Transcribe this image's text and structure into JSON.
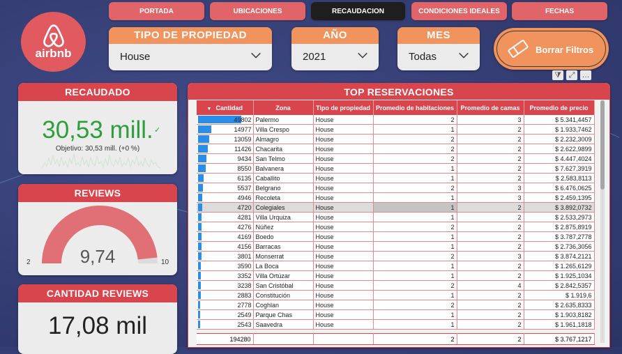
{
  "brand": {
    "logo_text": "airbnb",
    "color": "#e05a5f"
  },
  "nav": {
    "tabs": [
      "PORTADA",
      "UBICACIONES",
      "RECAUDACION",
      "CONDICIONES IDEALES",
      "FECHAS"
    ],
    "active": "RECAUDACION"
  },
  "filters": {
    "tipo": {
      "label": "TIPO DE PROPIEDAD",
      "value": "House"
    },
    "anio": {
      "label": "AÑO",
      "value": "2021"
    },
    "mes": {
      "label": "MES",
      "value": "Todas"
    },
    "clear_label": "Borrar Filtros"
  },
  "cards": {
    "recaudado": {
      "title": "RECAUDADO",
      "value": "30,53 mill.",
      "goal": "Objetivo: 30,53 mill. (+0 %)"
    },
    "reviews": {
      "title": "REVIEWS",
      "value": "9,74",
      "min": "2",
      "max": "10",
      "gauge_value": 9.74,
      "gauge_min": 2,
      "gauge_max": 10
    },
    "cantidad": {
      "title": "CANTIDAD REVIEWS",
      "value": "17,08 mil"
    }
  },
  "table": {
    "title": "TOP RESERVACIONES",
    "columns": [
      "Cantidad",
      "Zona",
      "Tipo de propiedad",
      "Promedio de habitaciones",
      "Promedio de camas",
      "Promedio de precio"
    ],
    "rows": [
      [
        "49802",
        "Palermo",
        "House",
        "2",
        "3",
        "$ 5.341,4457"
      ],
      [
        "14977",
        "Villa Crespo",
        "House",
        "1",
        "2",
        "$ 1.933,7462"
      ],
      [
        "13059",
        "Almagro",
        "House",
        "2",
        "2",
        "$ 2.232,3009"
      ],
      [
        "11426",
        "Chacarita",
        "House",
        "2",
        "2",
        "$ 2.622,9899"
      ],
      [
        "9434",
        "San Telmo",
        "House",
        "2",
        "2",
        "$ 4.447,4024"
      ],
      [
        "8550",
        "Balvanera",
        "House",
        "1",
        "2",
        "$ 7.627,3919"
      ],
      [
        "6135",
        "Caballito",
        "House",
        "1",
        "2",
        "$ 2.583,8113"
      ],
      [
        "5537",
        "Belgrano",
        "House",
        "2",
        "3",
        "$ 6.476,0625"
      ],
      [
        "4946",
        "Recoleta",
        "House",
        "1",
        "3",
        "$ 2.459,1395"
      ],
      [
        "4720",
        "Colegiales",
        "House",
        "1",
        "2",
        "$ 3.892,0732"
      ],
      [
        "4281",
        "Villa Urquiza",
        "House",
        "1",
        "2",
        "$ 2.533,2973"
      ],
      [
        "4276",
        "Núñez",
        "House",
        "2",
        "2",
        "$ 2.875,8919"
      ],
      [
        "4169",
        "Boedo",
        "House",
        "1",
        "2",
        "$ 3.787,2778"
      ],
      [
        "4156",
        "Barracas",
        "House",
        "1",
        "2",
        "$ 2.736,3056"
      ],
      [
        "3801",
        "Monserrat",
        "House",
        "2",
        "3",
        "$ 3.874,2121"
      ],
      [
        "3590",
        "La Boca",
        "House",
        "1",
        "2",
        "$ 1.265,6129"
      ],
      [
        "3352",
        "Villa Ortúzar",
        "House",
        "1",
        "2",
        "$ 1.925,1034"
      ],
      [
        "3238",
        "San Cristóbal",
        "House",
        "2",
        "4",
        "$ 2.842,5357"
      ],
      [
        "2883",
        "Constitución",
        "House",
        "1",
        "2",
        "$ 1.919,6"
      ],
      [
        "2778",
        "Coghlan",
        "House",
        "2",
        "2",
        "$ 2.635,8333"
      ],
      [
        "2549",
        "Parque Chas",
        "House",
        "1",
        "2",
        "$ 1.903,8182"
      ],
      [
        "2543",
        "Saavedra",
        "House",
        "1",
        "2",
        "$ 1.961,1818"
      ]
    ],
    "selected_row": 9,
    "bar_color": "#2a8de8",
    "totals": [
      "194280",
      "",
      "",
      "2",
      "2",
      "$ 3.767,1217"
    ]
  },
  "colors": {
    "header_red": "#d9454c",
    "filter_orange": "#f0935c",
    "kpi_green": "#2e9e3a",
    "nav_pink": "#e06468"
  }
}
